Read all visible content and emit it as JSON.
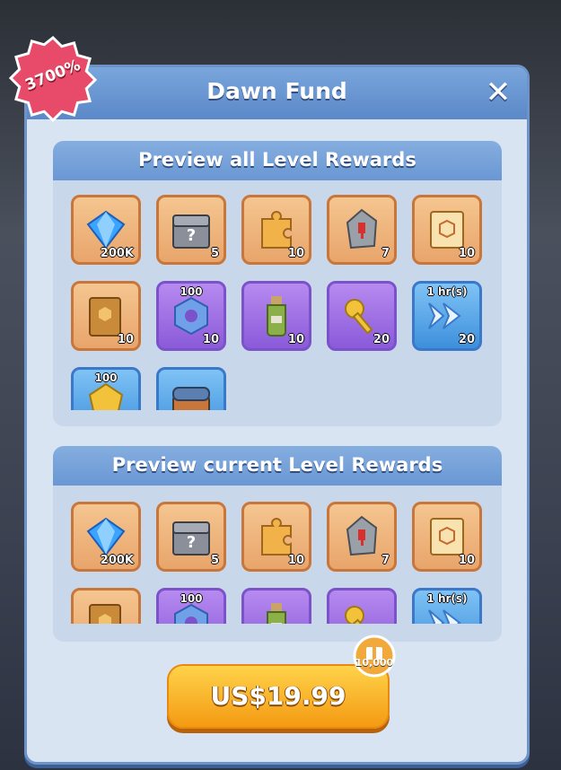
{
  "badge": {
    "text": "3700%"
  },
  "title": "Dawn Fund",
  "section_all": {
    "title": "Preview all Level Rewards",
    "items": [
      {
        "icon": "diamond-icon",
        "qty": "200K",
        "top": "",
        "style": "orange"
      },
      {
        "icon": "mystery-chest-icon",
        "qty": "5",
        "top": "",
        "style": "orange"
      },
      {
        "icon": "puzzle-piece-icon",
        "qty": "10",
        "top": "",
        "style": "orange"
      },
      {
        "icon": "stone-icon",
        "qty": "7",
        "top": "",
        "style": "orange"
      },
      {
        "icon": "scroll-icon",
        "qty": "10",
        "top": "",
        "style": "orange"
      },
      {
        "icon": "book-icon",
        "qty": "10",
        "top": "",
        "style": "orange"
      },
      {
        "icon": "gear-token-icon",
        "qty": "10",
        "top": "100",
        "style": "purple"
      },
      {
        "icon": "potion-bottle-icon",
        "qty": "10",
        "top": "",
        "style": "purple"
      },
      {
        "icon": "key-icon",
        "qty": "20",
        "top": "",
        "style": "purple"
      },
      {
        "icon": "speedup-arrows-icon",
        "qty": "20",
        "top": "1 hr(s)",
        "style": "blue"
      },
      {
        "icon": "gold-gem-icon",
        "qty": "",
        "top": "100",
        "style": "blue"
      },
      {
        "icon": "treasure-chest-icon",
        "qty": "",
        "top": "",
        "style": "blue"
      }
    ]
  },
  "section_current": {
    "title": "Preview current Level Rewards",
    "items": [
      {
        "icon": "diamond-icon",
        "qty": "200K",
        "top": "",
        "style": "orange"
      },
      {
        "icon": "mystery-chest-icon",
        "qty": "5",
        "top": "",
        "style": "orange"
      },
      {
        "icon": "puzzle-piece-icon",
        "qty": "10",
        "top": "",
        "style": "orange"
      },
      {
        "icon": "stone-icon",
        "qty": "7",
        "top": "",
        "style": "orange"
      },
      {
        "icon": "scroll-icon",
        "qty": "10",
        "top": "",
        "style": "orange"
      },
      {
        "icon": "book-icon",
        "qty": "",
        "top": "",
        "style": "orange"
      },
      {
        "icon": "gear-token-icon",
        "qty": "",
        "top": "100",
        "style": "purple"
      },
      {
        "icon": "potion-bottle-icon",
        "qty": "",
        "top": "",
        "style": "purple"
      },
      {
        "icon": "key-icon",
        "qty": "",
        "top": "",
        "style": "purple"
      },
      {
        "icon": "speedup-arrows-icon",
        "qty": "",
        "top": "1 hr(s)",
        "style": "blue"
      }
    ]
  },
  "purchase": {
    "price": "US$19.99",
    "bonus": "10,000"
  }
}
